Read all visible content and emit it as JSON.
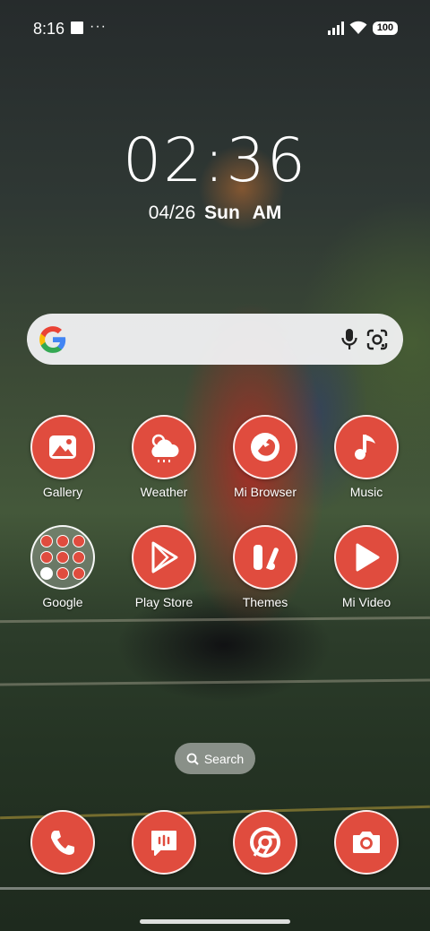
{
  "status_bar": {
    "time": "8:16",
    "dots": "···",
    "battery": "100"
  },
  "lock_clock": {
    "time": "02:36",
    "date": "04/26",
    "weekday": "Sun",
    "ampm": "AM"
  },
  "search_widget": {
    "icons": [
      "google-g-icon",
      "microphone-icon",
      "google-lens-icon"
    ]
  },
  "apps": [
    {
      "label": "Gallery",
      "icon": "gallery-icon"
    },
    {
      "label": "Weather",
      "icon": "weather-icon"
    },
    {
      "label": "Mi Browser",
      "icon": "mi-browser-icon"
    },
    {
      "label": "Music",
      "icon": "music-note-icon"
    },
    {
      "label": "Google",
      "icon": "folder-icon"
    },
    {
      "label": "Play Store",
      "icon": "play-store-icon"
    },
    {
      "label": "Themes",
      "icon": "themes-icon"
    },
    {
      "label": "Mi Video",
      "icon": "play-icon"
    }
  ],
  "folder_apps": [
    "google",
    "gmail",
    "maps",
    "youtube",
    "drive",
    "photos-like",
    "photos",
    "meet",
    "contacts"
  ],
  "search_pill": {
    "label": "Search",
    "icon": "search-icon"
  },
  "dock": [
    {
      "icon": "phone-icon"
    },
    {
      "icon": "messages-icon"
    },
    {
      "icon": "chrome-icon"
    },
    {
      "icon": "camera-icon"
    }
  ],
  "colors": {
    "app_icon": "#e04c3e",
    "search_bg": "#f5f5f7"
  }
}
